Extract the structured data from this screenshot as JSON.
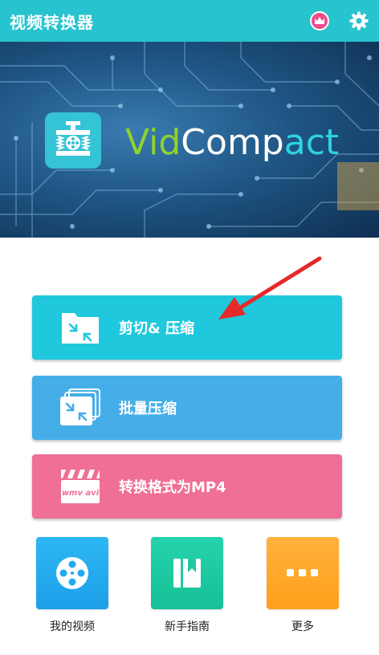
{
  "app": {
    "title": "视频转换器"
  },
  "banner": {
    "brand_parts": [
      "Vid",
      "Comp",
      "act"
    ]
  },
  "actions": [
    {
      "label": "剪切& 压缩",
      "color": "#1fc8dd",
      "icon": "folder-compress-icon"
    },
    {
      "label": "批量压缩",
      "color": "#45aee8",
      "icon": "stack-compress-icon"
    },
    {
      "label": "转换格式为MP4",
      "color": "#ef6f96",
      "icon": "clapper-wmv-avi-icon",
      "icon_text": "wmv avi"
    }
  ],
  "tiles": [
    {
      "label": "我的视频",
      "color": "#23aaf0",
      "icon": "film-reel-icon"
    },
    {
      "label": "新手指南",
      "color": "#1fcaa2",
      "icon": "guide-book-icon"
    },
    {
      "label": "更多",
      "color": "#ffa828",
      "icon": "more-dots-icon"
    }
  ],
  "colors": {
    "topbar": "#27c3cf",
    "crown": "#ec4f8c",
    "arrow": "#e52a2a"
  }
}
